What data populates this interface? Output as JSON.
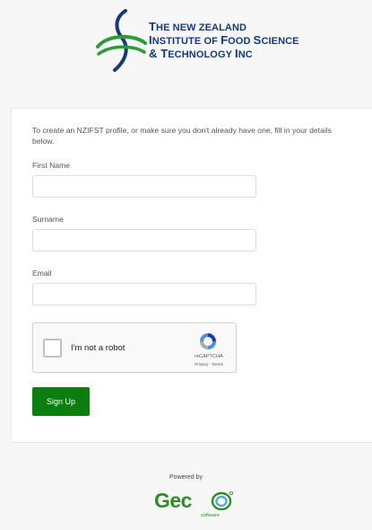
{
  "header": {
    "org_line1_big": "T",
    "org_line1_rest": "he New Zealand",
    "org_line2_big": "I",
    "org_line2_rest": "nstitute Of ",
    "org_line2_big2": "F",
    "org_line2_rest2": "ood ",
    "org_line2_big3": "S",
    "org_line2_rest3": "cience",
    "org_line3": "& ",
    "org_line3_big": "T",
    "org_line3_rest": "echnology ",
    "org_line3_big2": "I",
    "org_line3_rest2": "nc"
  },
  "form": {
    "intro": "To create an NZIFST profile, or make sure you don't already have one, fill in your details below.",
    "first_name_label": "First Name",
    "first_name_value": "",
    "surname_label": "Surname",
    "surname_value": "",
    "email_label": "Email",
    "email_value": "",
    "signup_label": "Sign Up"
  },
  "recaptcha": {
    "label": "I'm not a robot",
    "brand": "reCAPTCHA",
    "links": "Privacy - Terms",
    "checked": false
  },
  "footer": {
    "powered_by": "Powered by",
    "brand": "Gec",
    "brand_sub": "software"
  },
  "colors": {
    "logo_blue": "#163a78",
    "logo_green": "#2e9b3a",
    "signup_green": "#0c7d0f",
    "gecco_green": "#2f8d29"
  }
}
